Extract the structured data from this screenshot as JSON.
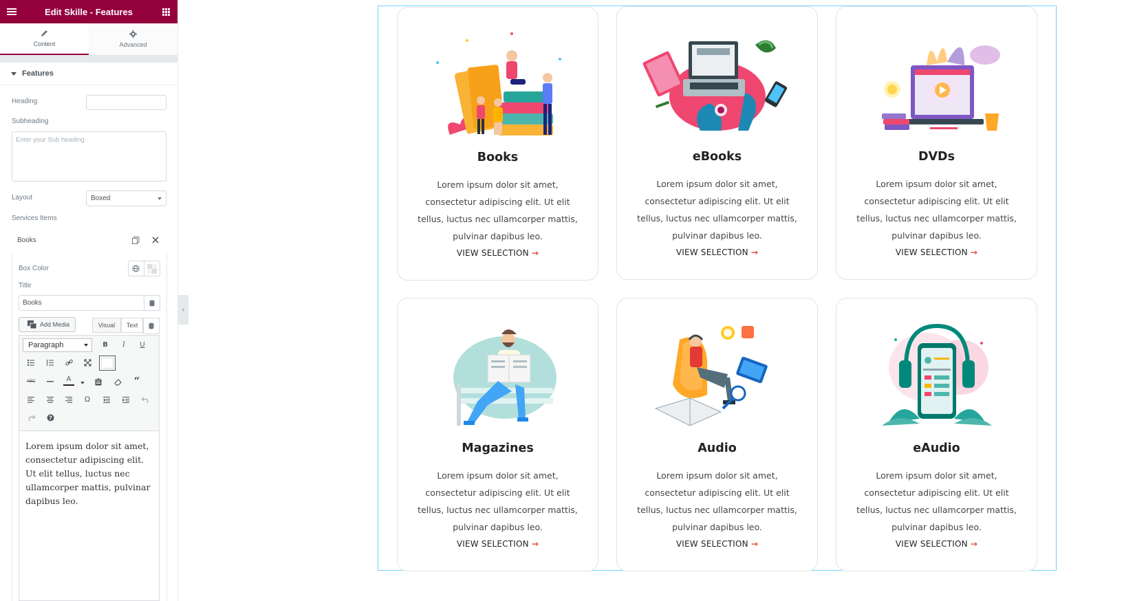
{
  "editor": {
    "title": "Edit Skille - Features",
    "tabs": [
      {
        "label": "Content",
        "icon": "pencil-icon"
      },
      {
        "label": "Advanced",
        "icon": "gear-icon"
      }
    ],
    "section": "Features",
    "fields": {
      "heading_label": "Heading",
      "heading_value": "",
      "subheading_label": "Subheading",
      "subheading_placeholder": "Enter your Sub heading",
      "layout_label": "Layout",
      "layout_value": "Boxed",
      "services_label": "Services Items"
    },
    "item": {
      "name": "Books",
      "box_color_label": "Box Color",
      "title_label": "Title",
      "title_value": "Books",
      "add_media": "Add Media",
      "visual_tab": "Visual",
      "text_tab": "Text",
      "paragraph": "Paragraph",
      "body": "Lorem ipsum dolor sit amet, consectetur adipiscing elit. Ut elit tellus, luctus nec ullamcorper mattis, pulvinar dapibus leo."
    }
  },
  "cards": [
    {
      "title": "Books",
      "illustration": "books-illustration",
      "link": "VIEW SELECTION",
      "desc": "Lorem ipsum dolor sit amet, consectetur adipiscing elit. Ut elit tellus, luctus nec ullamcorper mattis, pulvinar dapibus leo."
    },
    {
      "title": "eBooks",
      "illustration": "laptop-illustration",
      "link": "VIEW SELECTION",
      "desc": "Lorem ipsum dolor sit amet, consectetur adipiscing elit. Ut elit tellus, luctus nec ullamcorper mattis, pulvinar dapibus leo."
    },
    {
      "title": "DVDs",
      "illustration": "video-illustration",
      "link": "VIEW SELECTION",
      "desc": "Lorem ipsum dolor sit amet, consectetur adipiscing elit. Ut elit tellus, luctus nec ullamcorper mattis, pulvinar dapibus leo."
    },
    {
      "title": "Magazines",
      "illustration": "reader-illustration",
      "link": "VIEW SELECTION",
      "desc": "Lorem ipsum dolor sit amet, consectetur adipiscing elit. Ut elit tellus, luctus nec ullamcorper mattis, pulvinar dapibus leo."
    },
    {
      "title": "Audio",
      "illustration": "listener-illustration",
      "link": "VIEW SELECTION",
      "desc": "Lorem ipsum dolor sit amet, consectetur adipiscing elit. Ut elit tellus, luctus nec ullamcorper mattis, pulvinar dapibus leo."
    },
    {
      "title": "eAudio",
      "illustration": "headphones-phone-illustration",
      "link": "VIEW SELECTION",
      "desc": "Lorem ipsum dolor sit amet, consectetur adipiscing elit. Ut elit tellus, luctus nec ullamcorper mattis, pulvinar dapibus leo."
    }
  ],
  "colors": {
    "brand": "#93003c",
    "accent_arrow": "#e2453b",
    "canvas_outline": "#71d7f7"
  }
}
